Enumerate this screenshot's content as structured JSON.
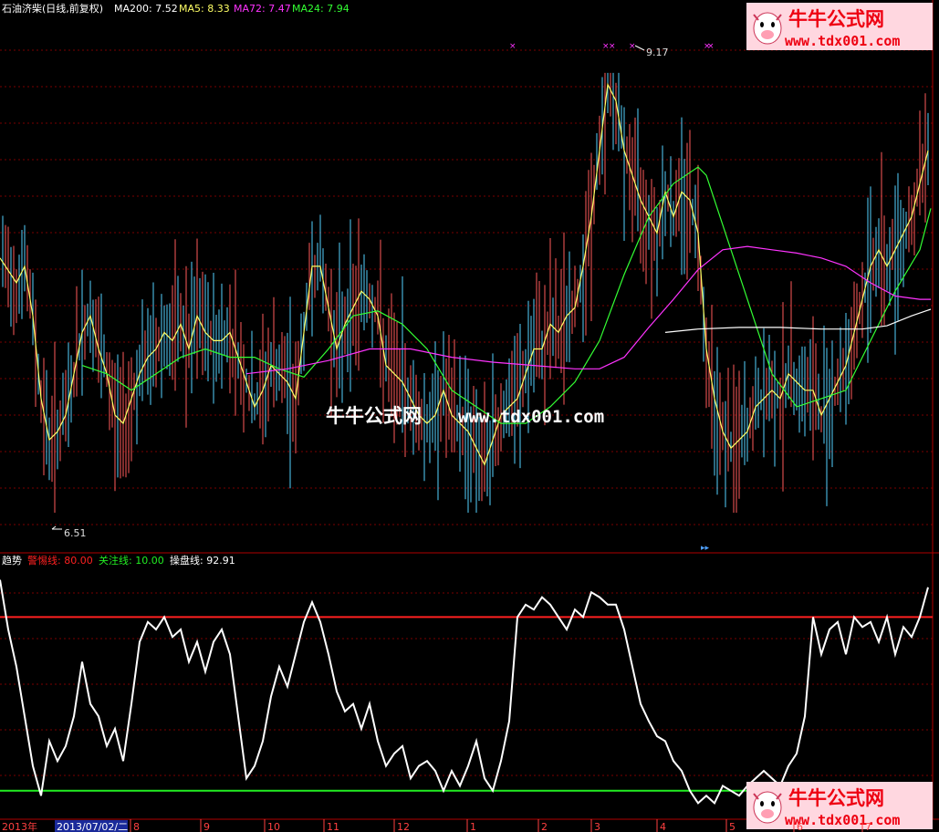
{
  "colors": {
    "background": "#000000",
    "grid": "#7a0000",
    "up_bar": "#ff5a5a",
    "down_bar": "#54d2ff",
    "ma200": "#ffffff",
    "ma5": "#ffff66",
    "ma72": "#ff33ff",
    "ma24": "#33ff33",
    "warn_line": "#ff2020",
    "focus_line": "#22ee22",
    "trend_line": "#ffffff",
    "axis_text": "#ff4040",
    "label_text": "#ffffff",
    "marker": "#ff33ff"
  },
  "main_panel": {
    "title": "石油济柴(日线,前复权)",
    "indicators": [
      {
        "label": "MA200",
        "value": "7.52",
        "color": "#ffffff"
      },
      {
        "label": "MA5",
        "value": "8.33",
        "color": "#ffff66"
      },
      {
        "label": "MA72",
        "value": "7.47",
        "color": "#ff33ff"
      },
      {
        "label": "MA24",
        "value": "7.94",
        "color": "#33ff33"
      }
    ],
    "high_label": "9.17",
    "low_label": "6.51"
  },
  "sub_panel": {
    "title": "趋势",
    "lines": [
      {
        "label": "警惕线",
        "value": "80.00",
        "color": "#ff2020"
      },
      {
        "label": "关注线",
        "value": "10.00",
        "color": "#22ee22"
      },
      {
        "label": "操盘线",
        "value": "92.91",
        "color": "#ffffff"
      }
    ]
  },
  "watermark": {
    "center_text": "牛牛公式网",
    "center_url": "www.tdx001.com",
    "corner_text": "牛牛公式网",
    "corner_url": "www.tdx001.com"
  },
  "time_axis": {
    "year_label": "2013年",
    "cursor_date": "2013/07/02/二",
    "months": [
      "8",
      "9",
      "10",
      "11",
      "12",
      "1",
      "2",
      "3",
      "4",
      "5",
      "6",
      "7"
    ]
  },
  "chart_data": {
    "type": "line",
    "price_range": [
      6.3,
      9.5
    ],
    "high": 9.17,
    "low": 6.51,
    "price_series": [
      {
        "name": "MA5",
        "x": [
          0,
          18,
          27,
          36,
          45,
          54,
          63,
          72,
          81,
          90,
          99,
          108,
          117,
          126,
          135,
          144,
          153,
          162,
          171,
          180,
          189,
          198,
          207,
          216,
          225,
          234,
          243,
          252,
          261,
          270,
          279,
          288,
          297,
          306,
          315,
          324,
          333,
          342,
          351,
          360,
          369,
          378,
          387,
          396,
          405,
          414,
          423,
          432,
          441,
          450,
          459,
          468,
          477,
          486,
          495,
          504,
          513,
          522,
          531,
          540,
          549,
          558,
          567,
          576,
          585,
          594,
          603,
          612,
          621,
          630,
          639,
          648,
          657,
          666,
          675,
          684,
          693,
          702,
          711,
          720,
          729,
          738,
          747,
          756,
          765,
          774,
          783,
          792,
          801,
          810,
          819,
          828,
          837,
          846,
          855,
          864,
          873,
          882,
          891,
          900,
          909,
          918,
          927,
          936,
          945,
          954,
          963,
          972,
          981,
          990,
          999,
          1008,
          1017
        ],
        "y": [
          8.05,
          7.9,
          8.0,
          7.7,
          7.2,
          6.95,
          7.0,
          7.1,
          7.35,
          7.6,
          7.7,
          7.5,
          7.35,
          7.1,
          7.05,
          7.2,
          7.35,
          7.45,
          7.5,
          7.6,
          7.55,
          7.65,
          7.5,
          7.7,
          7.6,
          7.55,
          7.55,
          7.6,
          7.45,
          7.3,
          7.15,
          7.25,
          7.4,
          7.35,
          7.3,
          7.2,
          7.6,
          8.0,
          8.0,
          7.75,
          7.5,
          7.65,
          7.75,
          7.85,
          7.8,
          7.7,
          7.4,
          7.35,
          7.3,
          7.2,
          7.1,
          7.05,
          7.1,
          7.25,
          7.1,
          7.05,
          7.0,
          6.9,
          6.8,
          6.95,
          7.1,
          7.15,
          7.2,
          7.35,
          7.5,
          7.5,
          7.65,
          7.6,
          7.7,
          7.75,
          8.0,
          8.3,
          8.7,
          9.1,
          9.0,
          8.7,
          8.55,
          8.4,
          8.3,
          8.2,
          8.45,
          8.3,
          8.45,
          8.4,
          8.2,
          7.5,
          7.2,
          7.0,
          6.9,
          6.95,
          7.0,
          7.15,
          7.2,
          7.25,
          7.2,
          7.35,
          7.3,
          7.25,
          7.25,
          7.1,
          7.2,
          7.3,
          7.4,
          7.6,
          7.8,
          8.0,
          8.1,
          8.0,
          8.1,
          8.2,
          8.3,
          8.5,
          8.7
        ]
      },
      {
        "name": "MA24",
        "x": [
          90,
          117,
          144,
          171,
          198,
          225,
          252,
          279,
          306,
          333,
          360,
          387,
          414,
          441,
          468,
          495,
          522,
          549,
          576,
          603,
          630,
          657,
          684,
          711,
          738,
          765,
          774,
          792,
          819,
          846,
          873,
          900,
          927,
          954,
          981,
          1008,
          1020
        ],
        "y": [
          7.4,
          7.35,
          7.25,
          7.35,
          7.45,
          7.5,
          7.45,
          7.45,
          7.38,
          7.33,
          7.5,
          7.7,
          7.73,
          7.65,
          7.5,
          7.25,
          7.15,
          7.05,
          7.05,
          7.15,
          7.3,
          7.55,
          7.95,
          8.3,
          8.5,
          8.6,
          8.55,
          8.25,
          7.8,
          7.35,
          7.15,
          7.2,
          7.25,
          7.55,
          7.85,
          8.1,
          8.35
        ]
      },
      {
        "name": "MA72",
        "x": [
          270,
          315,
          360,
          405,
          450,
          495,
          540,
          585,
          630,
          657,
          684,
          711,
          738,
          765,
          792,
          819,
          846,
          873,
          900,
          927,
          954,
          981,
          1008,
          1020
        ],
        "y": [
          7.35,
          7.38,
          7.43,
          7.5,
          7.5,
          7.45,
          7.42,
          7.4,
          7.38,
          7.38,
          7.45,
          7.63,
          7.8,
          7.98,
          8.1,
          8.12,
          8.1,
          8.08,
          8.05,
          8.0,
          7.9,
          7.82,
          7.8,
          7.8
        ]
      },
      {
        "name": "MA200",
        "x": [
          729,
          765,
          810,
          855,
          900,
          945,
          972,
          999,
          1020
        ],
        "y": [
          7.6,
          7.62,
          7.63,
          7.63,
          7.62,
          7.62,
          7.64,
          7.7,
          7.74
        ]
      }
    ],
    "trend_series": {
      "name": "操盘线",
      "y_range": [
        0,
        100
      ],
      "x": [
        0,
        9,
        18,
        27,
        36,
        45,
        54,
        63,
        72,
        81,
        90,
        99,
        108,
        117,
        126,
        135,
        144,
        153,
        162,
        171,
        180,
        189,
        198,
        207,
        216,
        225,
        234,
        243,
        252,
        261,
        270,
        279,
        288,
        297,
        306,
        315,
        324,
        333,
        342,
        351,
        360,
        369,
        378,
        387,
        396,
        405,
        414,
        423,
        432,
        441,
        450,
        459,
        468,
        477,
        486,
        495,
        504,
        513,
        522,
        531,
        540,
        549,
        558,
        567,
        576,
        585,
        594,
        603,
        612,
        621,
        630,
        639,
        648,
        657,
        666,
        675,
        684,
        693,
        702,
        711,
        720,
        729,
        738,
        747,
        756,
        765,
        774,
        783,
        792,
        801,
        810,
        819,
        828,
        837,
        846,
        855,
        864,
        873,
        882,
        891,
        900,
        909,
        918,
        927,
        936,
        945,
        954,
        963,
        972,
        981,
        990,
        999,
        1008,
        1017
      ],
      "y": [
        95,
        75,
        60,
        40,
        20,
        8,
        30,
        22,
        28,
        40,
        62,
        45,
        40,
        28,
        35,
        22,
        45,
        70,
        78,
        75,
        80,
        72,
        75,
        62,
        70,
        58,
        70,
        75,
        65,
        40,
        15,
        20,
        30,
        48,
        60,
        52,
        65,
        78,
        86,
        78,
        65,
        50,
        42,
        45,
        35,
        45,
        30,
        20,
        25,
        28,
        15,
        20,
        22,
        18,
        10,
        18,
        12,
        20,
        30,
        15,
        10,
        22,
        38,
        80,
        85,
        83,
        88,
        85,
        80,
        75,
        83,
        80,
        90,
        88,
        85,
        85,
        75,
        60,
        45,
        38,
        32,
        30,
        22,
        18,
        10,
        5,
        8,
        5,
        12,
        10,
        8,
        12,
        15,
        18,
        15,
        12,
        20,
        25,
        40,
        80,
        65,
        75,
        78,
        65,
        80,
        76,
        78,
        70,
        80,
        65,
        76,
        72,
        80,
        92
      ]
    },
    "sub_lines": [
      {
        "name": "警惕线",
        "value": 80.0
      },
      {
        "name": "关注线",
        "value": 10.0
      }
    ]
  }
}
